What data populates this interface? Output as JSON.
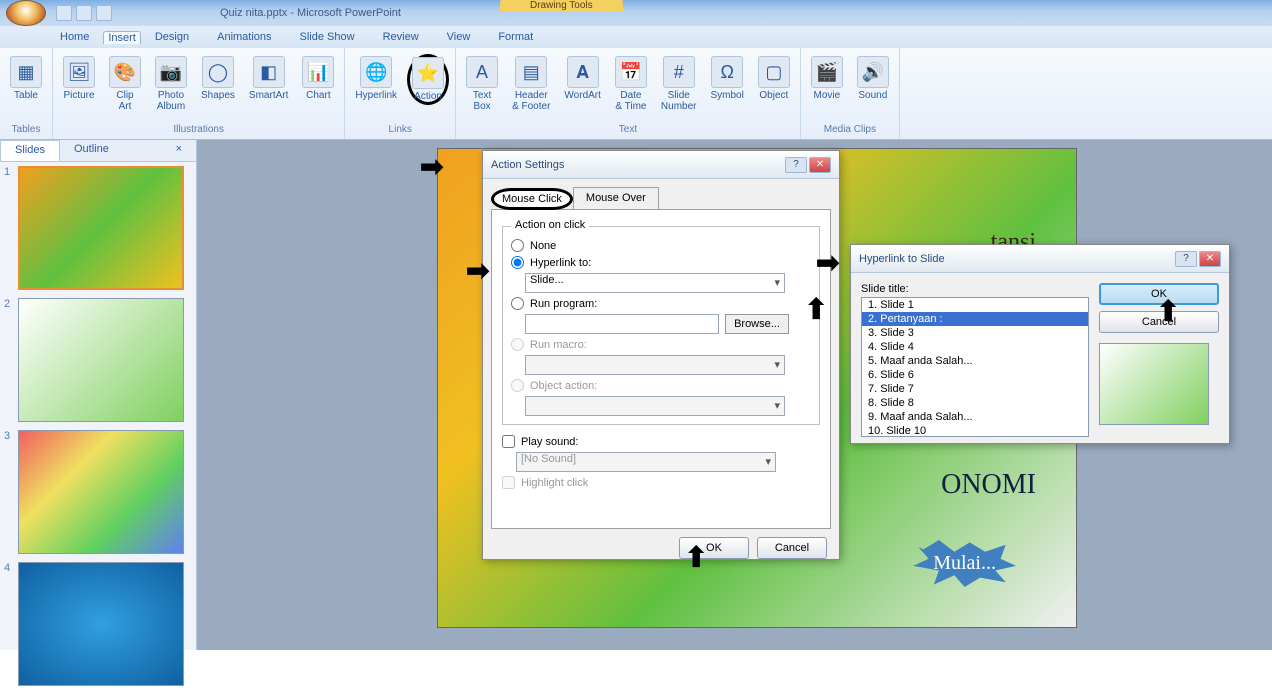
{
  "title": "Quiz nita.pptx - Microsoft PowerPoint",
  "context_tab": "Drawing Tools",
  "menu": {
    "home": "Home",
    "insert": "Insert",
    "design": "Design",
    "animations": "Animations",
    "slideshow": "Slide Show",
    "review": "Review",
    "view": "View",
    "format": "Format"
  },
  "ribbon": {
    "tables": {
      "title": "Tables",
      "table": "Table"
    },
    "illustrations": {
      "title": "Illustrations",
      "picture": "Picture",
      "clipart": "Clip\nArt",
      "photoalbum": "Photo\nAlbum",
      "shapes": "Shapes",
      "smartart": "SmartArt",
      "chart": "Chart"
    },
    "links": {
      "title": "Links",
      "hyperlink": "Hyperlink",
      "action": "Action"
    },
    "text": {
      "title": "Text",
      "textbox": "Text\nBox",
      "headerfooter": "Header\n& Footer",
      "wordart": "WordArt",
      "datetime": "Date\n& Time",
      "slidenumber": "Slide\nNumber",
      "symbol": "Symbol",
      "object": "Object"
    },
    "media": {
      "title": "Media Clips",
      "movie": "Movie",
      "sound": "Sound"
    }
  },
  "panel": {
    "slides": "Slides",
    "outline": "Outline"
  },
  "thumbs": [
    "1",
    "2",
    "3",
    "4"
  ],
  "action_dialog": {
    "title": "Action Settings",
    "tab_click": "Mouse Click",
    "tab_over": "Mouse Over",
    "group": "Action on click",
    "none": "None",
    "hyperlink": "Hyperlink to:",
    "hyperlink_val": "Slide...",
    "runprog": "Run program:",
    "browse": "Browse...",
    "runmacro": "Run macro:",
    "objaction": "Object action:",
    "playsound": "Play sound:",
    "sound_val": "[No Sound]",
    "highlight": "Highlight click",
    "ok": "OK",
    "cancel": "Cancel"
  },
  "hyper_dialog": {
    "title": "Hyperlink to Slide",
    "label": "Slide title:",
    "items": [
      "1. Slide 1",
      "2. Pertanyaan :",
      "3. Slide 3",
      "4. Slide 4",
      "5. Maaf anda Salah...",
      "6. Slide 6",
      "7. Slide 7",
      "8. Slide 8",
      "9. Maaf anda Salah...",
      "10. Slide 10"
    ],
    "selected": 1,
    "ok": "OK",
    "cancel": "Cancel"
  },
  "slide_text": {
    "onomi": "ONOMI",
    "tansi": "tansi",
    "mulai": "Mulai..."
  }
}
